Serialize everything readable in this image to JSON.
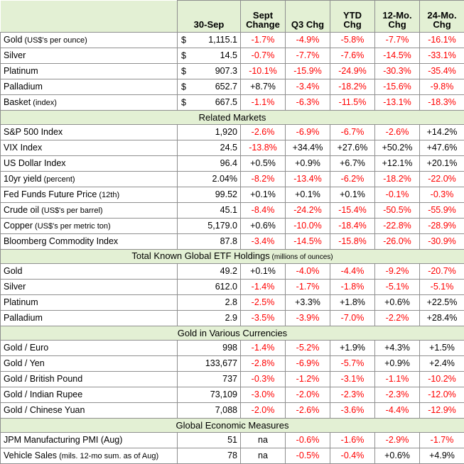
{
  "table": {
    "columns": [
      {
        "key": "label",
        "label": ""
      },
      {
        "key": "value",
        "label": "30-Sep"
      },
      {
        "key": "sept",
        "label": "Sept\nChange"
      },
      {
        "key": "q3",
        "label": "Q3 Chg"
      },
      {
        "key": "ytd",
        "label": "YTD\nChg"
      },
      {
        "key": "m12",
        "label": "12-Mo.\nChg"
      },
      {
        "key": "m24",
        "label": "24-Mo.\nChg"
      }
    ],
    "headers": {
      "blank": "",
      "date": "30-Sep",
      "sept_line1": "Sept",
      "sept_line2": "Change",
      "q3": "Q3 Chg",
      "ytd_line1": "YTD",
      "ytd_line2": "Chg",
      "m12_line1": "12-Mo.",
      "m12_line2": "Chg",
      "m24_line1": "24-Mo.",
      "m24_line2": "Chg"
    },
    "colors": {
      "header_background": "#E3F0D4",
      "section_background": "#E3F0D4",
      "negative_text": "#FF0000",
      "positive_text": "#000000",
      "border": "#8F8F8F"
    },
    "sections": [
      {
        "id": "metals",
        "title": "",
        "subtitle": "",
        "has_band": false,
        "rows": [
          {
            "name": "Gold",
            "qualifier": " (US$'s per ounce)",
            "currency": "$",
            "value": "1,115.1",
            "sept": "-1.7%",
            "q3": "-4.9%",
            "ytd": "-5.8%",
            "m12": "-7.7%",
            "m24": "-16.1%"
          },
          {
            "name": "Silver",
            "qualifier": "",
            "currency": "$",
            "value": "14.5",
            "sept": "-0.7%",
            "q3": "-7.7%",
            "ytd": "-7.6%",
            "m12": "-14.5%",
            "m24": "-33.1%"
          },
          {
            "name": "Platinum",
            "qualifier": "",
            "currency": "$",
            "value": "907.3",
            "sept": "-10.1%",
            "q3": "-15.9%",
            "ytd": "-24.9%",
            "m12": "-30.3%",
            "m24": "-35.4%"
          },
          {
            "name": "Palladium",
            "qualifier": "",
            "currency": "$",
            "value": "652.7",
            "sept": "+8.7%",
            "q3": "-3.4%",
            "ytd": "-18.2%",
            "m12": "-15.6%",
            "m24": "-9.8%"
          },
          {
            "name": "Basket",
            "qualifier": " (index)",
            "currency": "$",
            "value": "667.5",
            "sept": "-1.1%",
            "q3": "-6.3%",
            "ytd": "-11.5%",
            "m12": "-13.1%",
            "m24": "-18.3%"
          }
        ]
      },
      {
        "id": "related-markets",
        "title": "Related Markets",
        "subtitle": "",
        "has_band": true,
        "rows": [
          {
            "name": "S&P 500 Index",
            "qualifier": "",
            "currency": "",
            "value": "1,920",
            "sept": "-2.6%",
            "q3": "-6.9%",
            "ytd": "-6.7%",
            "m12": "-2.6%",
            "m24": "+14.2%"
          },
          {
            "name": "VIX Index",
            "qualifier": "",
            "currency": "",
            "value": "24.5",
            "sept": "-13.8%",
            "q3": "+34.4%",
            "ytd": "+27.6%",
            "m12": "+50.2%",
            "m24": "+47.6%"
          },
          {
            "name": "US Dollar Index",
            "qualifier": "",
            "currency": "",
            "value": "96.4",
            "sept": "+0.5%",
            "q3": "+0.9%",
            "ytd": "+6.7%",
            "m12": "+12.1%",
            "m24": "+20.1%"
          },
          {
            "name": "10yr yield",
            "qualifier": " (percent)",
            "currency": "",
            "value": "2.04%",
            "sept": "-8.2%",
            "q3": "-13.4%",
            "ytd": "-6.2%",
            "m12": "-18.2%",
            "m24": "-22.0%"
          },
          {
            "name": "Fed Funds Future Price",
            "qualifier": " (12th)",
            "currency": "",
            "value": "99.52",
            "sept": "+0.1%",
            "q3": "+0.1%",
            "ytd": "+0.1%",
            "m12": "-0.1%",
            "m24": "-0.3%"
          },
          {
            "name": "Crude oil",
            "qualifier": " (US$'s per barrel)",
            "currency": "",
            "value": "45.1",
            "sept": "-8.4%",
            "q3": "-24.2%",
            "ytd": "-15.4%",
            "m12": "-50.5%",
            "m24": "-55.9%"
          },
          {
            "name": "Copper",
            "qualifier": " (US$'s per metric ton)",
            "currency": "",
            "value": "5,179.0",
            "sept": "+0.6%",
            "q3": "-10.0%",
            "ytd": "-18.4%",
            "m12": "-22.8%",
            "m24": "-28.9%"
          },
          {
            "name": "Bloomberg Commodity Index",
            "qualifier": "",
            "currency": "",
            "value": "87.8",
            "sept": "-3.4%",
            "q3": "-14.5%",
            "ytd": "-15.8%",
            "m12": "-26.0%",
            "m24": "-30.9%"
          }
        ]
      },
      {
        "id": "etf-holdings",
        "title": "Total Known Global ETF Holdings",
        "subtitle": " (millions of ounces)",
        "has_band": true,
        "rows": [
          {
            "name": "Gold",
            "qualifier": "",
            "currency": "",
            "value": "49.2",
            "sept": "+0.1%",
            "q3": "-4.0%",
            "ytd": "-4.4%",
            "m12": "-9.2%",
            "m24": "-20.7%"
          },
          {
            "name": "Silver",
            "qualifier": "",
            "currency": "",
            "value": "612.0",
            "sept": "-1.4%",
            "q3": "-1.7%",
            "ytd": "-1.8%",
            "m12": "-5.1%",
            "m24": "-5.1%"
          },
          {
            "name": "Platinum",
            "qualifier": "",
            "currency": "",
            "value": "2.8",
            "sept": "-2.5%",
            "q3": "+3.3%",
            "ytd": "+1.8%",
            "m12": "+0.6%",
            "m24": "+22.5%"
          },
          {
            "name": "Palladium",
            "qualifier": "",
            "currency": "",
            "value": "2.9",
            "sept": "-3.5%",
            "q3": "-3.9%",
            "ytd": "-7.0%",
            "m12": "-2.2%",
            "m24": "+28.4%"
          }
        ]
      },
      {
        "id": "gold-currencies",
        "title": "Gold in Various Currencies",
        "subtitle": "",
        "has_band": true,
        "rows": [
          {
            "name": "Gold / Euro",
            "qualifier": "",
            "currency": "",
            "value": "998",
            "sept": "-1.4%",
            "q3": "-5.2%",
            "ytd": "+1.9%",
            "m12": "+4.3%",
            "m24": "+1.5%"
          },
          {
            "name": "Gold / Yen",
            "qualifier": "",
            "currency": "",
            "value": "133,677",
            "sept": "-2.8%",
            "q3": "-6.9%",
            "ytd": "-5.7%",
            "m12": "+0.9%",
            "m24": "+2.4%"
          },
          {
            "name": "Gold / British Pound",
            "qualifier": "",
            "currency": "",
            "value": "737",
            "sept": "-0.3%",
            "q3": "-1.2%",
            "ytd": "-3.1%",
            "m12": "-1.1%",
            "m24": "-10.2%"
          },
          {
            "name": "Gold / Indian Rupee",
            "qualifier": "",
            "currency": "",
            "value": "73,109",
            "sept": "-3.0%",
            "q3": "-2.0%",
            "ytd": "-2.3%",
            "m12": "-2.3%",
            "m24": "-12.0%"
          },
          {
            "name": "Gold / Chinese Yuan",
            "qualifier": "",
            "currency": "",
            "value": "7,088",
            "sept": "-2.0%",
            "q3": "-2.6%",
            "ytd": "-3.6%",
            "m12": "-4.4%",
            "m24": "-12.9%"
          }
        ]
      },
      {
        "id": "global-economic",
        "title": "Global Economic Measures",
        "subtitle": "",
        "has_band": true,
        "rows": [
          {
            "name": "JPM Manufacturing PMI (Aug)",
            "qualifier": "",
            "currency": "",
            "value": "51",
            "sept": "na",
            "q3": "-0.6%",
            "ytd": "-1.6%",
            "m12": "-2.9%",
            "m24": "-1.7%"
          },
          {
            "name": "Vehicle Sales",
            "qualifier": " (mils. 12-mo sum. as of Aug)",
            "currency": "",
            "value": "78",
            "sept": "na",
            "q3": "-0.5%",
            "ytd": "-0.4%",
            "m12": "+0.6%",
            "m24": "+4.9%"
          }
        ]
      }
    ]
  }
}
